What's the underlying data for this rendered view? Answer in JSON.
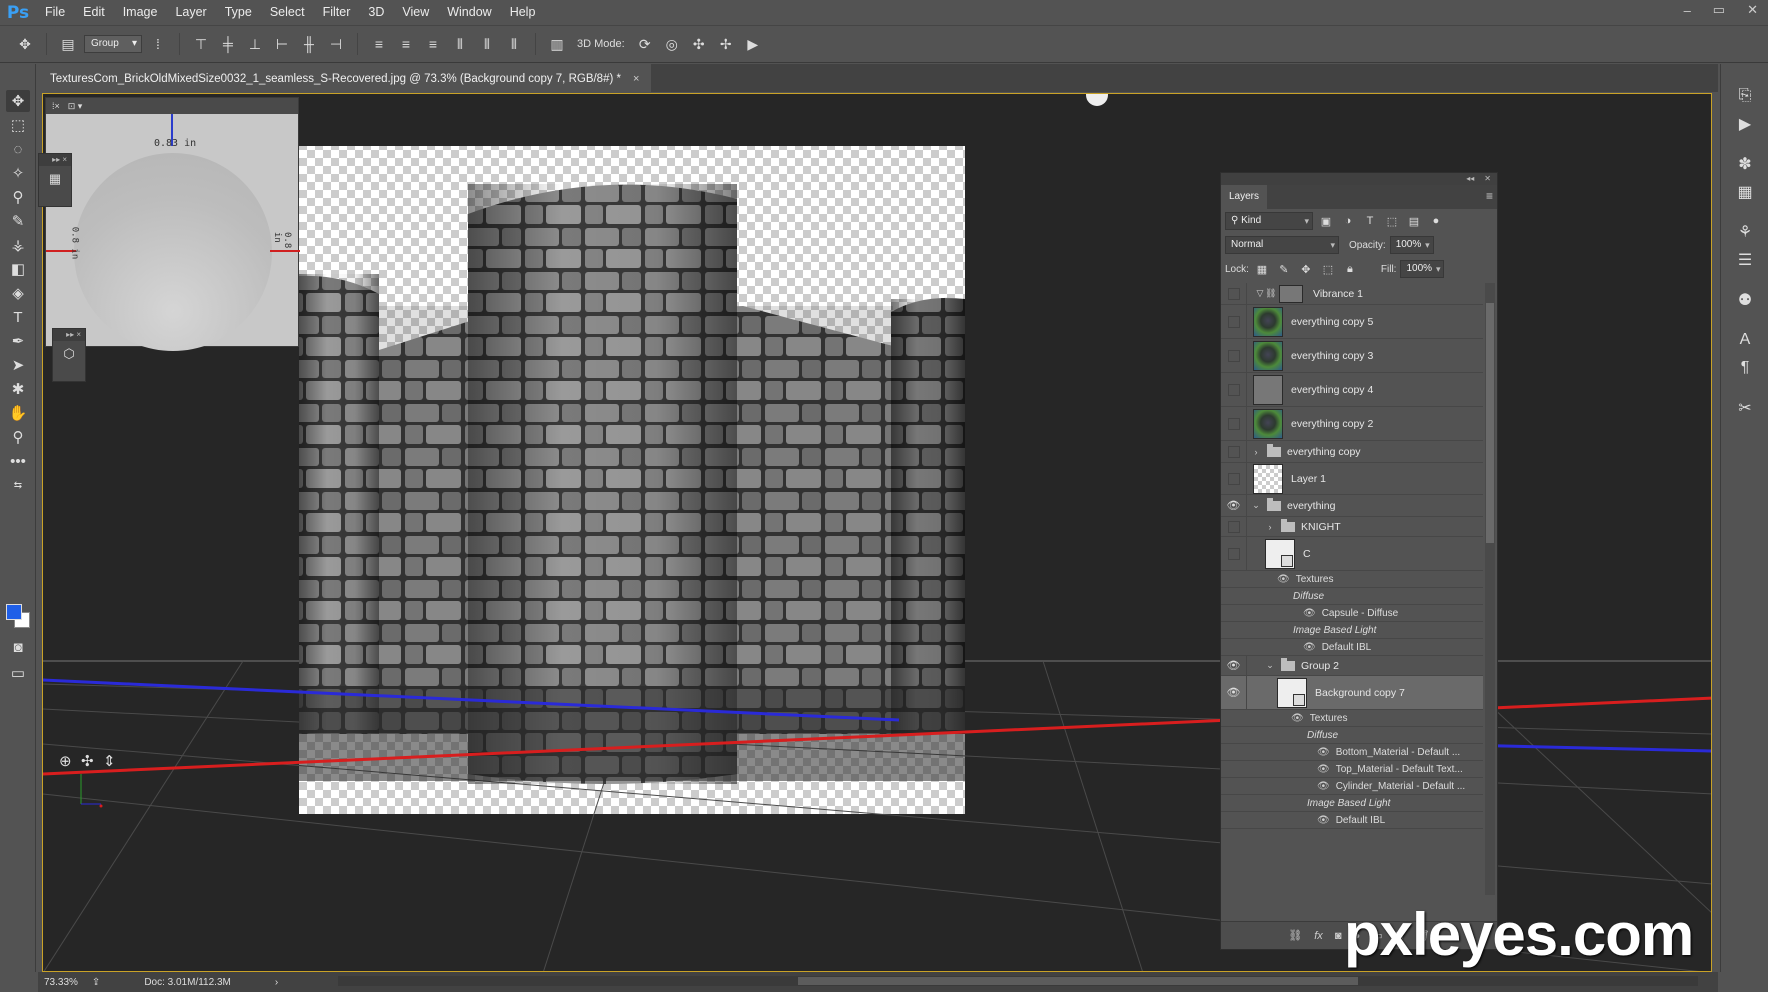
{
  "app": {
    "logo": "Ps",
    "menu": [
      "File",
      "Edit",
      "Image",
      "Layer",
      "Type",
      "Select",
      "Filter",
      "3D",
      "View",
      "Window",
      "Help"
    ],
    "window_controls": [
      "–",
      "▭",
      "✕"
    ]
  },
  "options_bar": {
    "group_select": "Group",
    "mode_label": "3D Mode:"
  },
  "document": {
    "tab_title": "TexturesCom_BrickOldMixedSize0032_1_seamless_S-Recovered.jpg @ 73.3% (Background copy 7, RGB/8#) *",
    "tab_close": "×"
  },
  "properties_mini": {
    "readout_top": "0.83 in",
    "readout_left": "0.8 in",
    "readout_right": "0.8 in"
  },
  "layers_panel": {
    "tab_label": "Layers",
    "filter_kind": "Kind",
    "blend_mode": "Normal",
    "opacity_label": "Opacity:",
    "opacity_value": "100%",
    "lock_label": "Lock:",
    "fill_label": "Fill:",
    "fill_value": "100%",
    "layers": [
      {
        "name": "Vibrance 1",
        "kind": "adjustment",
        "visible": false
      },
      {
        "name": "everything copy 5",
        "kind": "image-green",
        "visible": false
      },
      {
        "name": "everything copy 3",
        "kind": "image-green",
        "visible": false
      },
      {
        "name": "everything copy 4",
        "kind": "image-gray",
        "visible": false
      },
      {
        "name": "everything copy 2",
        "kind": "image-green",
        "visible": false
      },
      {
        "name": "everything copy",
        "kind": "group",
        "visible": false
      },
      {
        "name": "Layer 1",
        "kind": "image-check",
        "visible": false
      },
      {
        "name": "everything",
        "kind": "group-open",
        "visible": true
      },
      {
        "name": "KNIGHT",
        "kind": "group",
        "visible": false
      },
      {
        "name": "C",
        "kind": "3d",
        "visible": false
      }
    ],
    "c_sub": {
      "textures": "Textures",
      "diffuse": "Diffuse",
      "capsule": "Capsule - Diffuse",
      "ibl": "Image Based Light",
      "default_ibl": "Default IBL"
    },
    "group2": "Group 2",
    "selected_layer": "Background copy 7",
    "bg_sub": {
      "textures": "Textures",
      "diffuse": "Diffuse",
      "bottom": "Bottom_Material - Default ...",
      "top": "Top_Material - Default Text...",
      "cylinder": "Cylinder_Material - Default ...",
      "ibl": "Image Based Light",
      "default_ibl": "Default IBL"
    },
    "bottom_fx": "fx"
  },
  "status_bar": {
    "zoom": "73.33%",
    "doc": "Doc: 3.01M/112.3M"
  },
  "watermark": "pxleyes.com",
  "colors": {
    "foreground": "#1f5fe8",
    "background": "#ffffff",
    "axis_x": "#d81e1e",
    "axis_z": "#2a2ad8"
  }
}
